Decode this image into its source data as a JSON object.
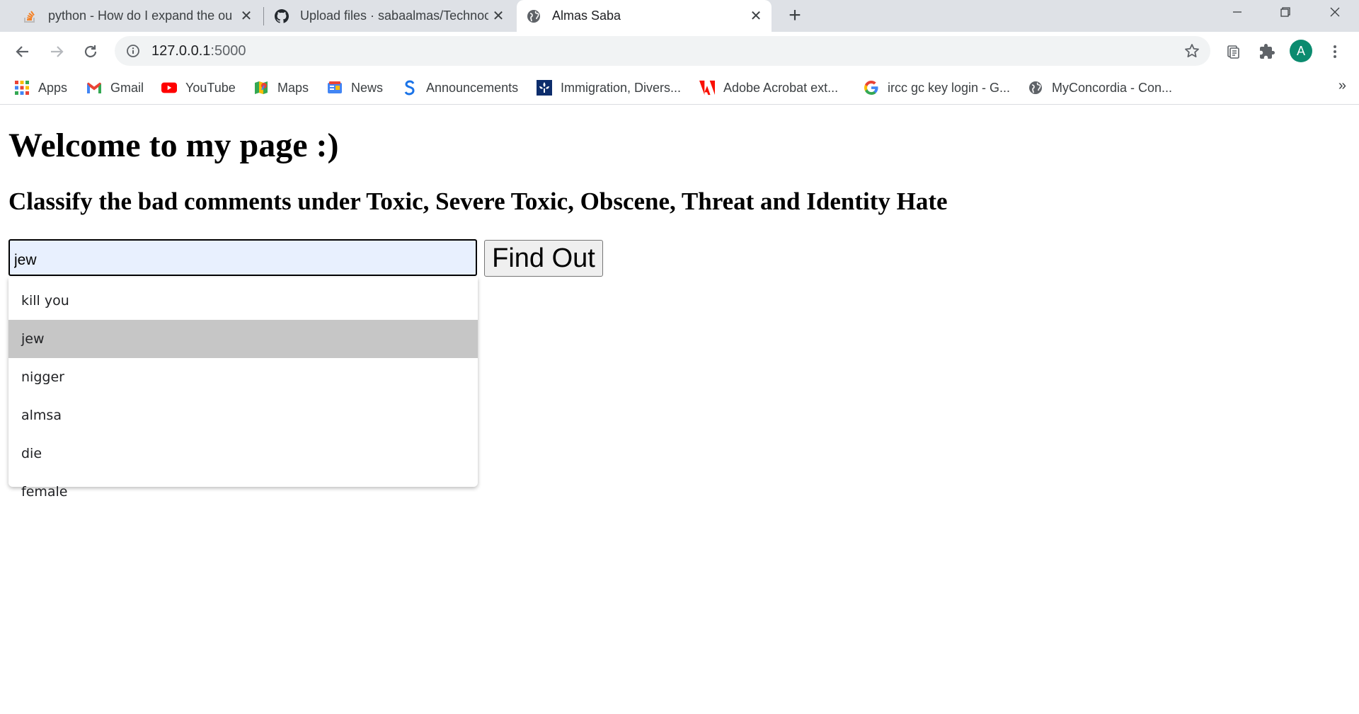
{
  "browser": {
    "tabs": [
      {
        "title": "python - How do I expand the ou",
        "favicon": "stackoverflow-icon"
      },
      {
        "title": "Upload files · sabaalmas/Technoc",
        "favicon": "github-icon"
      },
      {
        "title": "Almas Saba",
        "favicon": "globe-icon"
      }
    ],
    "close_glyph": "✕",
    "new_tab_glyph": "+",
    "window_controls": {
      "minimize": "—",
      "restore": "❐",
      "close": "✕"
    },
    "url_host": "127.0.0.1",
    "url_port": ":5000",
    "avatar_letter": "A",
    "bookmarks": [
      {
        "label": "Apps",
        "icon": "apps-grid-icon"
      },
      {
        "label": "Gmail",
        "icon": "gmail-icon"
      },
      {
        "label": "YouTube",
        "icon": "youtube-icon"
      },
      {
        "label": "Maps",
        "icon": "maps-icon"
      },
      {
        "label": "News",
        "icon": "news-icon"
      },
      {
        "label": "Announcements",
        "icon": "announcements-icon"
      },
      {
        "label": "Immigration, Divers...",
        "icon": "canada-fleur-icon"
      },
      {
        "label": "Adobe Acrobat ext...",
        "icon": "adobe-icon"
      },
      {
        "label": "ircc gc key login - G...",
        "icon": "google-icon"
      },
      {
        "label": "MyConcordia - Con...",
        "icon": "globe-icon"
      }
    ],
    "bookmarks_more": "»"
  },
  "page": {
    "heading": "Welcome to my page :)",
    "subheading": "Classify the bad comments under Toxic, Severe Toxic, Obscene, Threat and Identity Hate",
    "input_value": "jew",
    "button_label": "Find Out",
    "suggestions": [
      "kill you",
      "jew",
      "nigger",
      "almsa",
      "die",
      "female"
    ],
    "selected_suggestion_index": 1
  }
}
